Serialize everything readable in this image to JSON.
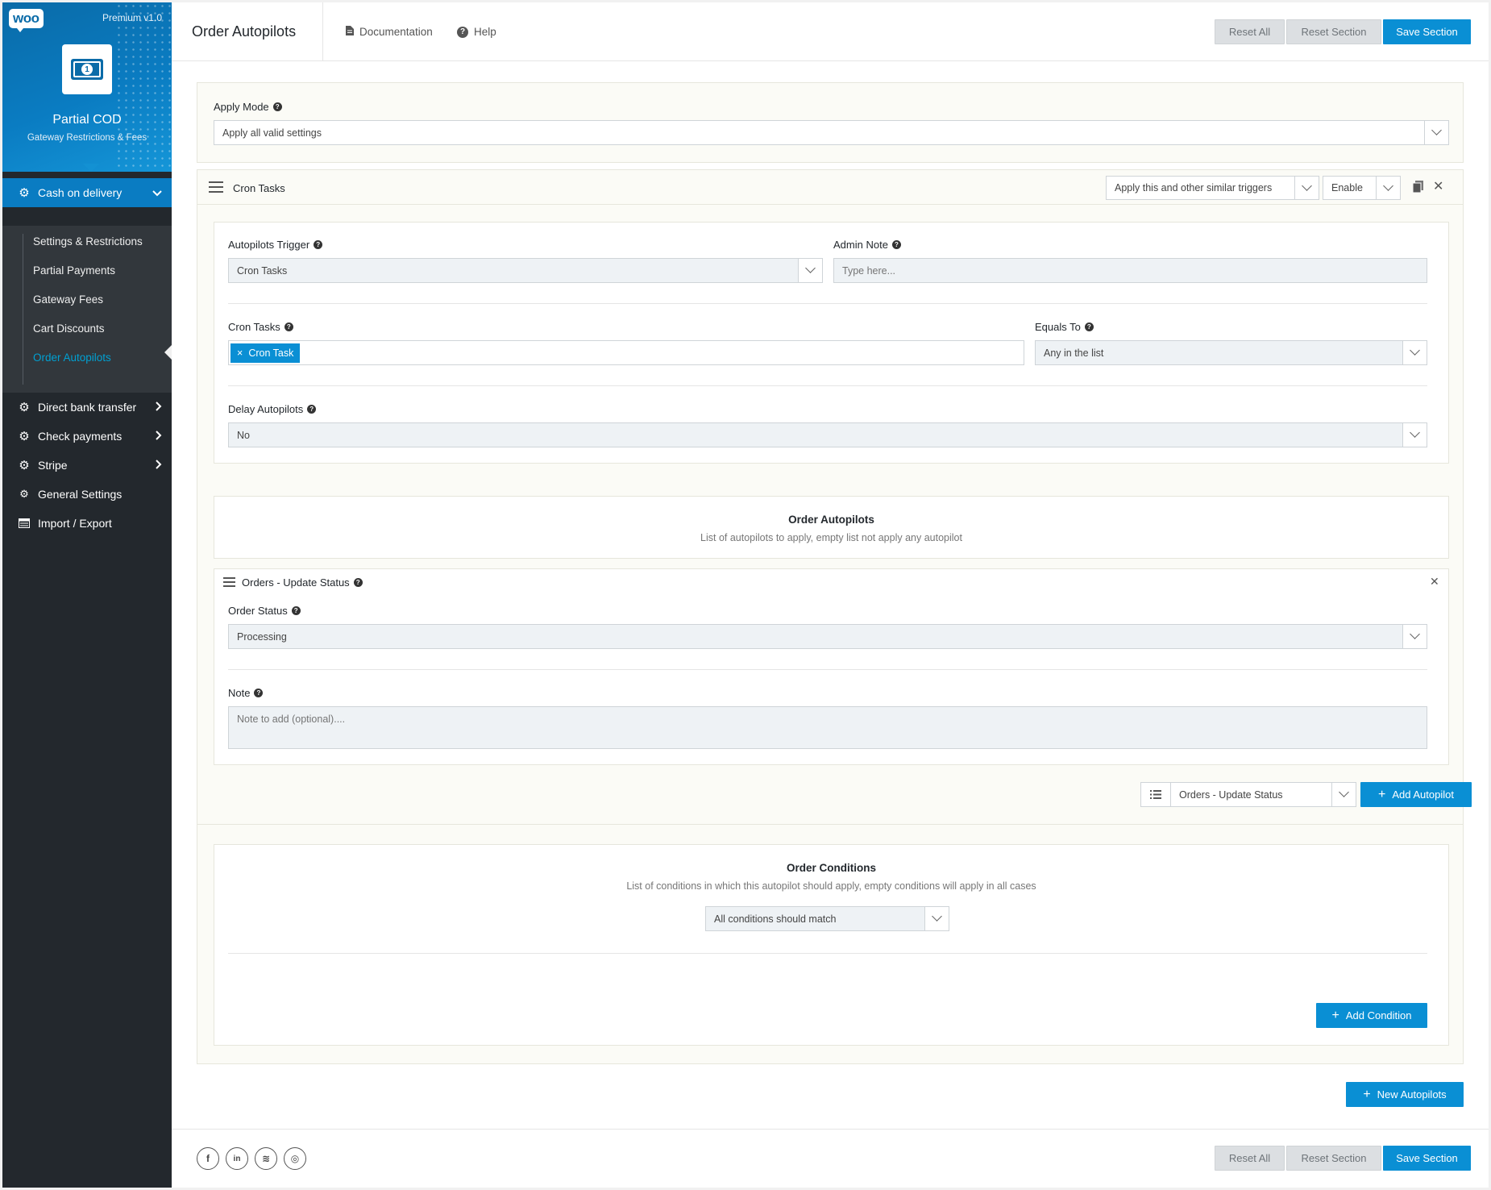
{
  "brand": {
    "logo": "woo",
    "edition": "Premium v1.0",
    "app_name": "Partial COD",
    "app_subtitle": "Gateway Restrictions & Fees"
  },
  "sidebar": {
    "active_gateway": "Cash on delivery",
    "sub_items": [
      {
        "label": "Settings & Restrictions"
      },
      {
        "label": "Partial Payments"
      },
      {
        "label": "Gateway Fees"
      },
      {
        "label": "Cart Discounts"
      },
      {
        "label": "Order Autopilots"
      }
    ],
    "items": [
      {
        "label": "Direct bank transfer",
        "icon": "gear-icon"
      },
      {
        "label": "Check payments",
        "icon": "gear-icon"
      },
      {
        "label": "Stripe",
        "icon": "gear-icon"
      },
      {
        "label": "General Settings",
        "icon": "gears-icon"
      },
      {
        "label": "Import / Export",
        "icon": "import-export-icon"
      }
    ]
  },
  "header": {
    "title": "Order Autopilots",
    "documentation": "Documentation",
    "help": "Help",
    "reset_all": "Reset All",
    "reset_section": "Reset Section",
    "save_section": "Save Section"
  },
  "apply_mode": {
    "label": "Apply Mode",
    "value": "Apply all valid settings"
  },
  "cron_panel": {
    "title": "Cron Tasks",
    "apply_select": "Apply this and other similar triggers",
    "enable_select": "Enable",
    "trigger_label": "Autopilots Trigger",
    "trigger_value": "Cron Tasks",
    "admin_note_label": "Admin Note",
    "admin_note_placeholder": "Type here...",
    "cron_tasks_label": "Cron Tasks",
    "cron_tag": "Cron Task",
    "equals_label": "Equals To",
    "equals_value": "Any in the list",
    "delay_label": "Delay Autopilots",
    "delay_value": "No"
  },
  "autopilots": {
    "title": "Order Autopilots",
    "subtitle": "List of autopilots to apply, empty list not apply any autopilot",
    "item_title": "Orders - Update Status",
    "status_label": "Order Status",
    "status_value": "Processing",
    "note_label": "Note",
    "note_placeholder": "Note to add (optional)....",
    "add_select": "Orders - Update Status",
    "add_button": "Add Autopilot"
  },
  "conditions": {
    "title": "Order Conditions",
    "subtitle": "List of conditions in which this autopilot should apply, empty conditions will apply in all cases",
    "match_select": "All conditions should match",
    "add_button": "Add Condition"
  },
  "new_autopilots": "New Autopilots",
  "footer": {
    "reset_all": "Reset All",
    "reset_section": "Reset Section",
    "save_section": "Save Section",
    "social": [
      {
        "icon": "facebook-icon",
        "glyph": "f"
      },
      {
        "icon": "linkedin-icon",
        "glyph": "in"
      },
      {
        "icon": "stackoverflow-icon",
        "glyph": "≋"
      },
      {
        "icon": "instagram-icon",
        "glyph": "◎"
      }
    ]
  },
  "colors": {
    "accent": "#0a8fd4",
    "sidebar": "#23282d",
    "panel_bg": "#fbfbf6"
  }
}
